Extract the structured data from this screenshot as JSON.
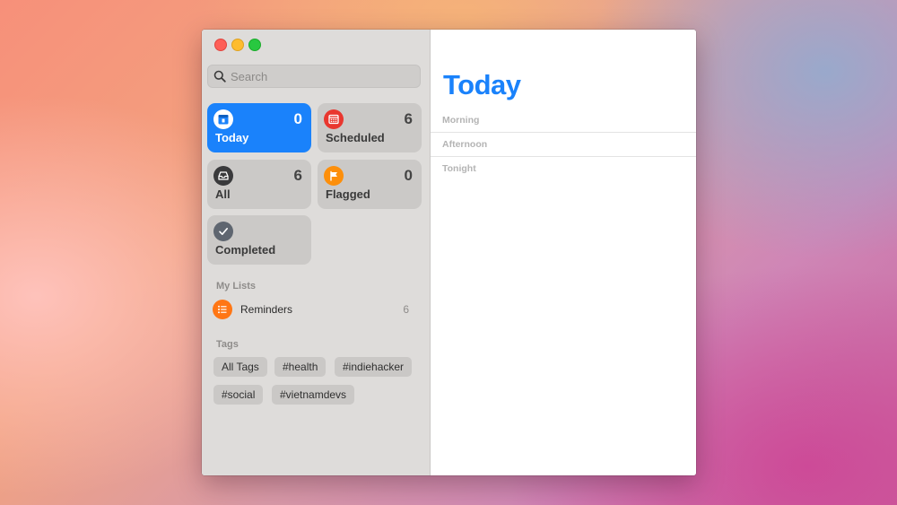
{
  "window": {
    "controls": [
      "close",
      "minimize",
      "zoom"
    ]
  },
  "sidebar": {
    "search": {
      "placeholder": "Search",
      "value": ""
    },
    "smart_lists": [
      {
        "label": "Today",
        "count": "0",
        "icon": "calendar-today-icon",
        "color": "#1a82fb",
        "selected": true
      },
      {
        "label": "Scheduled",
        "count": "6",
        "icon": "calendar-grid-icon",
        "color": "#e9372f",
        "selected": false
      },
      {
        "label": "All",
        "count": "6",
        "icon": "tray-icon",
        "color": "#3a3a3c",
        "selected": false
      },
      {
        "label": "Flagged",
        "count": "0",
        "icon": "flag-icon",
        "color": "#fd8f0b",
        "selected": false
      },
      {
        "label": "Completed",
        "count": "",
        "icon": "checkmark-icon",
        "color": "#5f6670",
        "selected": false
      }
    ],
    "my_lists_title": "My Lists",
    "lists": [
      {
        "name": "Reminders",
        "count": "6",
        "icon": "list-bullet-icon",
        "color": "#ff7614"
      }
    ],
    "tags_title": "Tags",
    "tags": [
      "All Tags",
      "#health",
      "#indiehacker",
      "#social",
      "#vietnamdevs"
    ]
  },
  "main": {
    "title": "Today",
    "title_color": "#1a82fb",
    "groups": [
      "Morning",
      "Afternoon",
      "Tonight"
    ]
  }
}
